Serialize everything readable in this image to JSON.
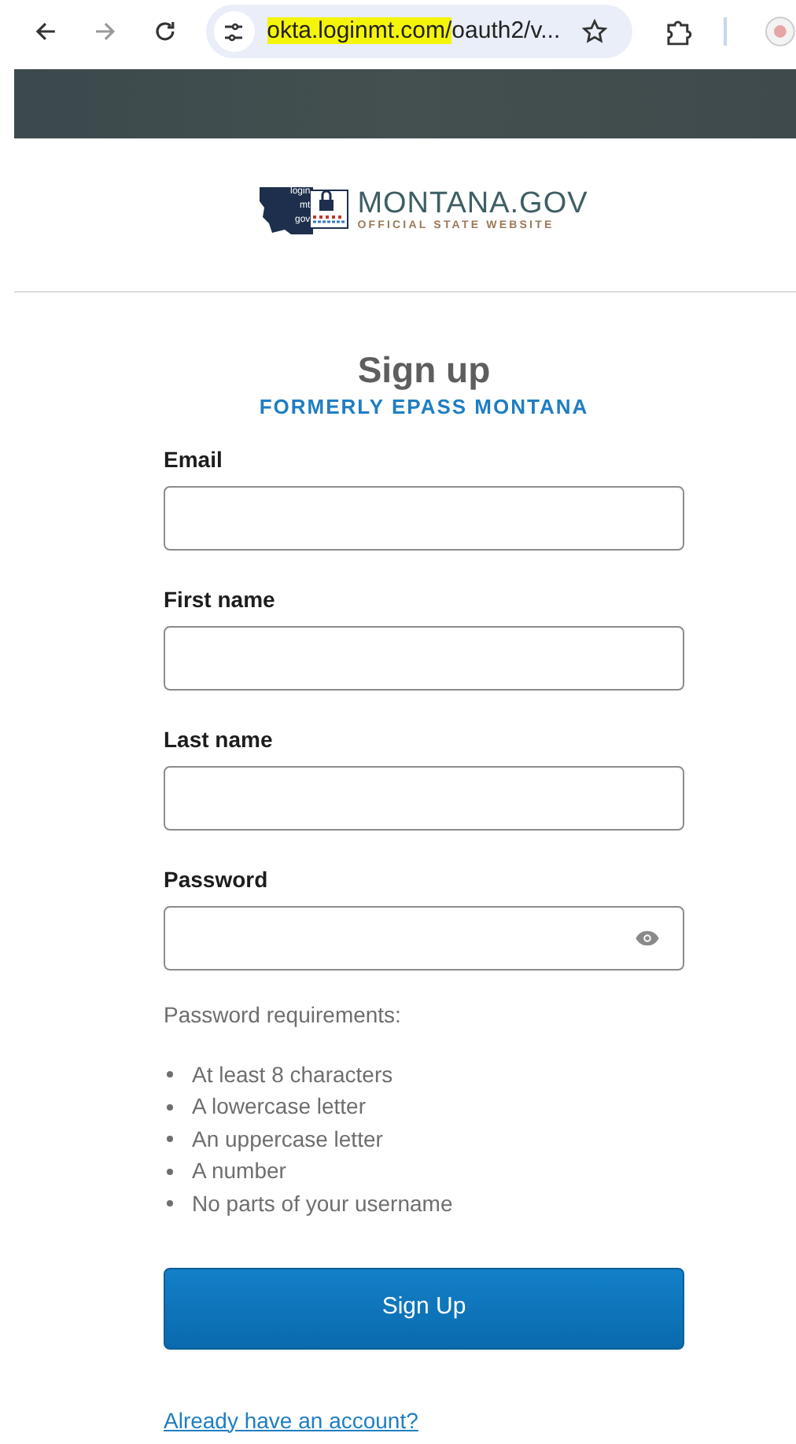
{
  "browser": {
    "url_parts": [
      {
        "text": "okta.loginmt.com/",
        "highlighted": true
      },
      {
        "text": "oauth2/v...",
        "highlighted": false
      }
    ]
  },
  "logo": {
    "badge_lines": [
      "login",
      "mt",
      "gov"
    ],
    "title": "MONTANA.GOV",
    "subtitle": "OFFICIAL STATE WEBSITE"
  },
  "heading": "Sign up",
  "subheading": "FORMERLY EPASS MONTANA",
  "fields": [
    {
      "label": "Email",
      "kind": "text"
    },
    {
      "label": "First name",
      "kind": "text"
    },
    {
      "label": "Last name",
      "kind": "text"
    },
    {
      "label": "Password",
      "kind": "password"
    }
  ],
  "requirements": {
    "title": "Password requirements:",
    "items": [
      "At least 8 characters",
      "A lowercase letter",
      "An uppercase letter",
      "A number",
      "No parts of your username"
    ]
  },
  "submit": "Sign Up",
  "link": "Already have an account?"
}
